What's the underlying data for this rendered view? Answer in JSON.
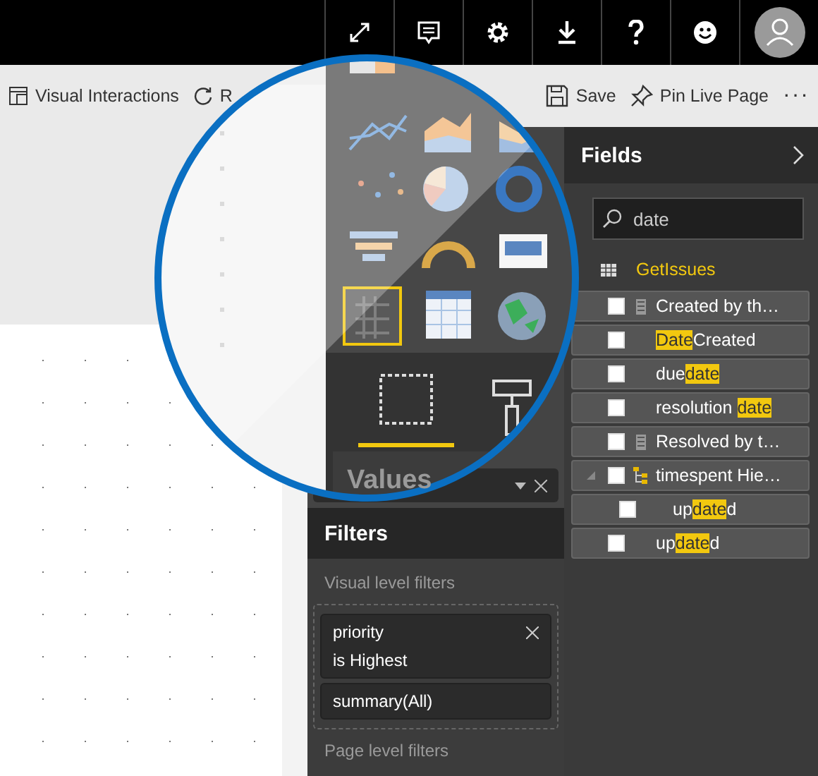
{
  "top_bar": {
    "buttons": [
      {
        "kind": "expand"
      },
      {
        "kind": "comment"
      },
      {
        "kind": "settings"
      },
      {
        "kind": "download"
      },
      {
        "kind": "help"
      },
      {
        "kind": "smiley"
      },
      {
        "kind": "avatar"
      }
    ]
  },
  "toolbar": {
    "items": [
      {
        "kind": "interactions",
        "label": "Visual Interactions"
      },
      {
        "kind": "refresh",
        "label": "R"
      },
      {
        "kind": "save",
        "label": "Save"
      },
      {
        "kind": "pin",
        "label": "Pin Live Page"
      },
      {
        "kind": "more",
        "label": "···"
      }
    ]
  },
  "visualizations": {
    "well_label": "Values"
  },
  "filters": {
    "title": "Filters",
    "visual_level_label": "Visual level filters",
    "items": [
      {
        "field": "priority",
        "condition": "is Highest",
        "removable": true
      },
      {
        "field": "summary(All)",
        "removable": false
      }
    ],
    "page_level_label": "Page level filters"
  },
  "fields": {
    "title": "Fields",
    "search": {
      "value": "date"
    },
    "tables": [
      {
        "name": "GetIssues",
        "items": [
          {
            "kind": "measure",
            "checked": false,
            "parts": [
              {
                "text": "Created by th…",
                "highlighted": false
              }
            ]
          },
          {
            "kind": "field",
            "checked": false,
            "parts": [
              {
                "text": "Date",
                "highlighted": true
              },
              {
                "text": "Created",
                "highlighted": false
              }
            ]
          },
          {
            "kind": "field",
            "checked": false,
            "parts": [
              {
                "text": "due",
                "highlighted": false
              },
              {
                "text": "date",
                "highlighted": true
              }
            ]
          },
          {
            "kind": "field",
            "checked": false,
            "parts": [
              {
                "text": "resolution ",
                "highlighted": false
              },
              {
                "text": "date",
                "highlighted": true
              }
            ]
          },
          {
            "kind": "measure",
            "checked": false,
            "parts": [
              {
                "text": "Resolved by t…",
                "highlighted": false
              }
            ]
          },
          {
            "kind": "hierarchy",
            "checked": false,
            "expanded": true,
            "parts": [
              {
                "text": "timespent Hie…",
                "highlighted": false
              }
            ],
            "children": [
              {
                "kind": "field",
                "checked": false,
                "parts": [
                  {
                    "text": "up",
                    "highlighted": false
                  },
                  {
                    "text": "date",
                    "highlighted": true
                  },
                  {
                    "text": "d",
                    "highlighted": false
                  }
                ]
              }
            ]
          },
          {
            "kind": "field",
            "checked": false,
            "parts": [
              {
                "text": "up",
                "highlighted": false
              },
              {
                "text": "date",
                "highlighted": true
              },
              {
                "text": "d",
                "highlighted": false
              }
            ]
          }
        ]
      }
    ]
  }
}
